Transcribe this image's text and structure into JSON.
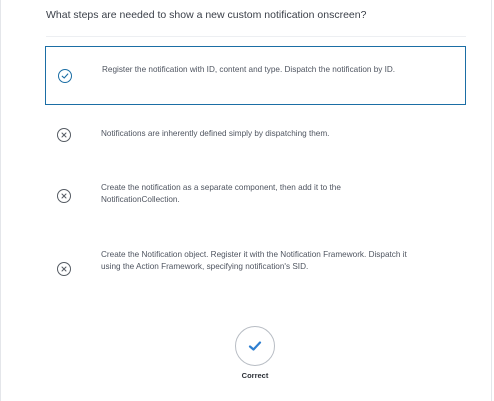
{
  "question": "What steps are needed to show a new custom notification onscreen?",
  "options": [
    {
      "text": "Register the notification with ID, content and type. Dispatch the notification by ID.",
      "icon": "check-circle-icon",
      "selected": true
    },
    {
      "text": "Notifications are inherently defined simply by dispatching them.",
      "icon": "x-circle-icon",
      "selected": false
    },
    {
      "text": "Create the notification as a separate component, then add it to the NotificationCollection.",
      "icon": "x-circle-icon",
      "selected": false
    },
    {
      "text": "Create the Notification object. Register it with the Notification Framework. Dispatch it using the Action Framework, specifying notification's SID.",
      "icon": "x-circle-icon",
      "selected": false
    }
  ],
  "result": {
    "label": "Correct",
    "icon": "check-icon"
  },
  "colors": {
    "accent": "#1b6ea5",
    "check": "#2f7fd0",
    "text": "#4f5560",
    "question": "#3a3f48"
  }
}
